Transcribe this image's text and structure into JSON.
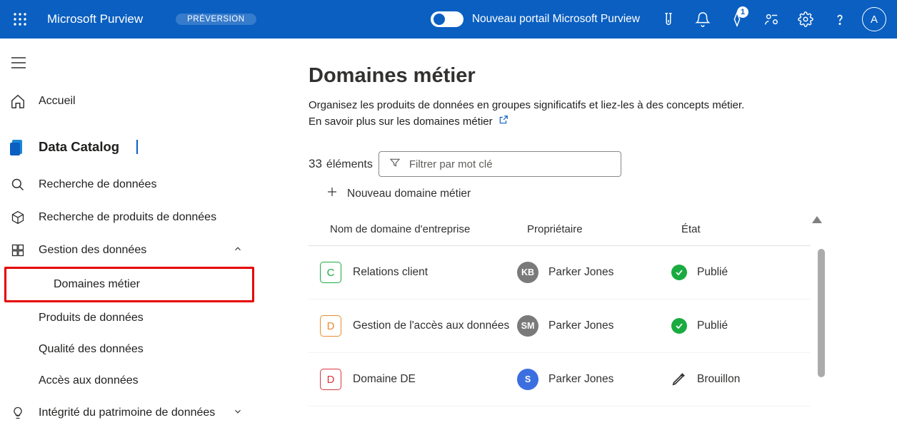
{
  "header": {
    "brand": "Microsoft Purview",
    "preview_badge": "PRÉVERSION",
    "toggle_label": "Nouveau portail Microsoft Purview",
    "notification_count": "1",
    "avatar_initial": "A"
  },
  "sidebar": {
    "home": "Accueil",
    "section": "Data Catalog",
    "items": {
      "search_data": "Recherche de données",
      "search_products": "Recherche de produits de données",
      "data_mgmt": "Gestion des données",
      "business_domains": "Domaines métier",
      "data_products": "Produits de données",
      "data_quality": "Qualité des données",
      "data_access": "Accès aux données",
      "integrity": "Intégrité du patrimoine de données"
    }
  },
  "main": {
    "title": "Domaines métier",
    "desc_line1": "Organisez les produits de données en groupes significatifs et liez-les à des concepts métier.",
    "learn_more": "En savoir plus sur les domaines métier",
    "count_num": "33",
    "count_label": "éléments",
    "filter_placeholder": "Filtrer par mot clé",
    "new_domain": "Nouveau domaine métier",
    "cols": {
      "name": "Nom de domaine d'entreprise",
      "owner": "Propriétaire",
      "state": "État"
    },
    "rows": [
      {
        "letter": "C",
        "letter_class": "letter-green",
        "name": "Relations client",
        "owner_initials": "KB",
        "owner_av": "av-grey",
        "owner": "Parker Jones",
        "state_type": "published",
        "state": "Publié"
      },
      {
        "letter": "D",
        "letter_class": "letter-orange",
        "name": "Gestion de l'accès aux données",
        "owner_initials": "SM",
        "owner_av": "av-grey",
        "owner": "Parker Jones",
        "state_type": "published",
        "state": "Publié"
      },
      {
        "letter": "D",
        "letter_class": "letter-red",
        "name": "Domaine DE",
        "owner_initials": "S",
        "owner_av": "av-blue",
        "owner": "Parker Jones",
        "state_type": "draft",
        "state": "Brouillon"
      }
    ]
  }
}
